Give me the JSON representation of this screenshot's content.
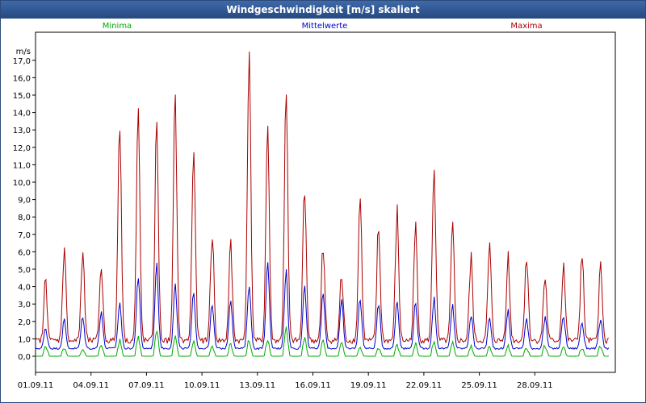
{
  "window": {
    "title": "Windgeschwindigkeit [m/s] skaliert"
  },
  "chart_data": {
    "type": "line",
    "title": "Windgeschwindigkeit [m/s] skaliert",
    "ylabel": "m/s",
    "ylim": [
      0,
      17.5
    ],
    "xlim": [
      0,
      31.4
    ],
    "y_ticks": [
      "0,0",
      "1,0",
      "2,0",
      "3,0",
      "4,0",
      "5,0",
      "6,0",
      "7,0",
      "8,0",
      "9,0",
      "10,0",
      "11,0",
      "12,0",
      "13,0",
      "14,0",
      "15,0",
      "16,0",
      "17,0"
    ],
    "y_tick_values": [
      0,
      1,
      2,
      3,
      4,
      5,
      6,
      7,
      8,
      9,
      10,
      11,
      12,
      13,
      14,
      15,
      16,
      17
    ],
    "x_ticks": [
      "01.09.11",
      "04.09.11",
      "07.09.11",
      "10.09.11",
      "13.09.11",
      "16.09.11",
      "19.09.11",
      "22.09.11",
      "25.09.11",
      "28.09.11"
    ],
    "x_tick_values": [
      0,
      3,
      6,
      9,
      12,
      15,
      18,
      21,
      24,
      27
    ],
    "grid": true,
    "legend_position": "top",
    "series": [
      {
        "name": "Minima",
        "color": "#00aa00",
        "daily_peaks": [
          0.6,
          0.5,
          0.4,
          0.6,
          0.9,
          1.1,
          1.5,
          1.1,
          0.8,
          0.5,
          0.7,
          0.9,
          1.0,
          1.6,
          1.0,
          0.9,
          0.8,
          0.6,
          0.5,
          0.6,
          0.7,
          0.9,
          0.8,
          0.6,
          0.5,
          0.6,
          0.5,
          0.6,
          0.5,
          0.5,
          0.6
        ]
      },
      {
        "name": "Mittelwerte",
        "color": "#0000cc",
        "daily_peaks": [
          1.6,
          2.0,
          2.2,
          2.6,
          3.1,
          4.6,
          5.2,
          4.1,
          3.6,
          2.9,
          3.3,
          4.2,
          5.3,
          4.9,
          4.1,
          3.6,
          3.1,
          3.3,
          3.0,
          3.2,
          3.1,
          3.3,
          2.9,
          2.4,
          2.1,
          2.6,
          2.1,
          2.2,
          2.4,
          2.0,
          2.1
        ]
      },
      {
        "name": "Maxima",
        "color": "#aa0000",
        "daily_peaks": [
          4.3,
          6.2,
          5.9,
          5.2,
          13.7,
          13.9,
          13.3,
          15.0,
          12.0,
          7.2,
          6.2,
          17.5,
          13.3,
          15.0,
          10.0,
          6.1,
          4.6,
          9.2,
          7.3,
          8.2,
          7.3,
          11.0,
          7.3,
          5.5,
          6.2,
          5.6,
          5.9,
          4.6,
          5.3,
          5.7,
          5.0
        ]
      }
    ]
  }
}
